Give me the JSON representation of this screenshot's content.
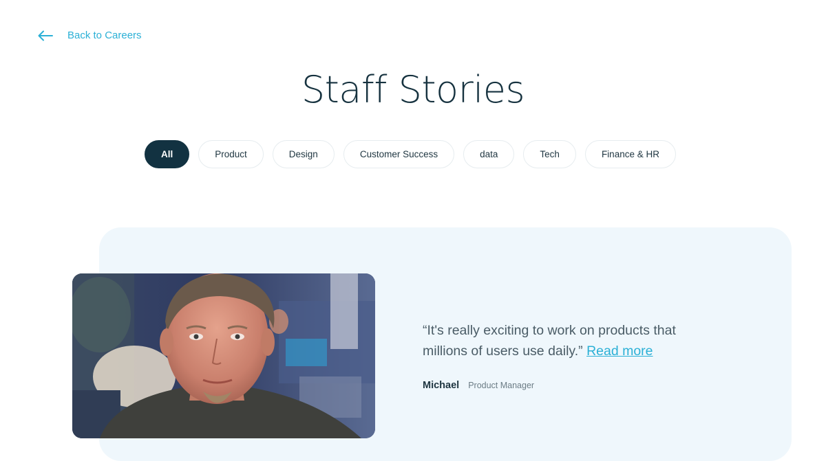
{
  "nav": {
    "back_label": "Back to Careers",
    "back_icon": "arrow-left-icon"
  },
  "page": {
    "title": "Staff Stories"
  },
  "filters": [
    {
      "label": "All",
      "active": true
    },
    {
      "label": "Product",
      "active": false
    },
    {
      "label": "Design",
      "active": false
    },
    {
      "label": "Customer Success",
      "active": false
    },
    {
      "label": "data",
      "active": false
    },
    {
      "label": "Tech",
      "active": false
    },
    {
      "label": "Finance & HR",
      "active": false
    }
  ],
  "story": {
    "quote": "“It's really exciting to work on products that millions of users use daily.”",
    "read_more": "Read more",
    "author_name": "Michael",
    "author_role": "Product Manager"
  },
  "colors": {
    "accent": "#2bb0d6",
    "dark": "#123241",
    "panel_bg": "#eff7fc"
  }
}
